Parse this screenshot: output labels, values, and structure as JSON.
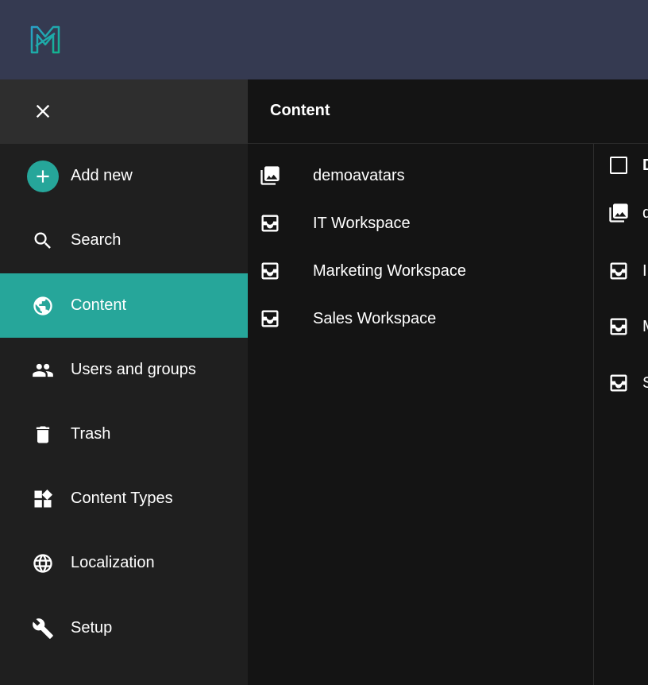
{
  "app": {
    "logo_icon": "sensenet-logo-icon",
    "accent_color": "#26a69a",
    "topbar_color": "#353a51"
  },
  "sidebar": {
    "close_icon": "close-icon",
    "items": [
      {
        "label": "Add new",
        "icon": "add-circle-icon"
      },
      {
        "label": "Search",
        "icon": "search-icon"
      },
      {
        "label": "Content",
        "icon": "globe-icon",
        "active": true
      },
      {
        "label": "Users and groups",
        "icon": "people-icon"
      },
      {
        "label": "Trash",
        "icon": "trash-icon"
      },
      {
        "label": "Content Types",
        "icon": "widgets-icon"
      },
      {
        "label": "Localization",
        "icon": "language-icon"
      },
      {
        "label": "Setup",
        "icon": "wrench-icon"
      }
    ]
  },
  "content": {
    "title": "Content",
    "tree": [
      {
        "label": "demoavatars",
        "icon": "image-library-icon"
      },
      {
        "label": "IT Workspace",
        "icon": "workspace-icon"
      },
      {
        "label": "Marketing Workspace",
        "icon": "workspace-icon"
      },
      {
        "label": "Sales Workspace",
        "icon": "workspace-icon"
      }
    ],
    "list": [
      {
        "label": "D",
        "icon": "checkbox-icon"
      },
      {
        "label": "d",
        "icon": "image-library-icon"
      },
      {
        "label": "I",
        "icon": "workspace-icon"
      },
      {
        "label": "M",
        "icon": "workspace-icon"
      },
      {
        "label": "S",
        "icon": "workspace-icon"
      }
    ]
  }
}
